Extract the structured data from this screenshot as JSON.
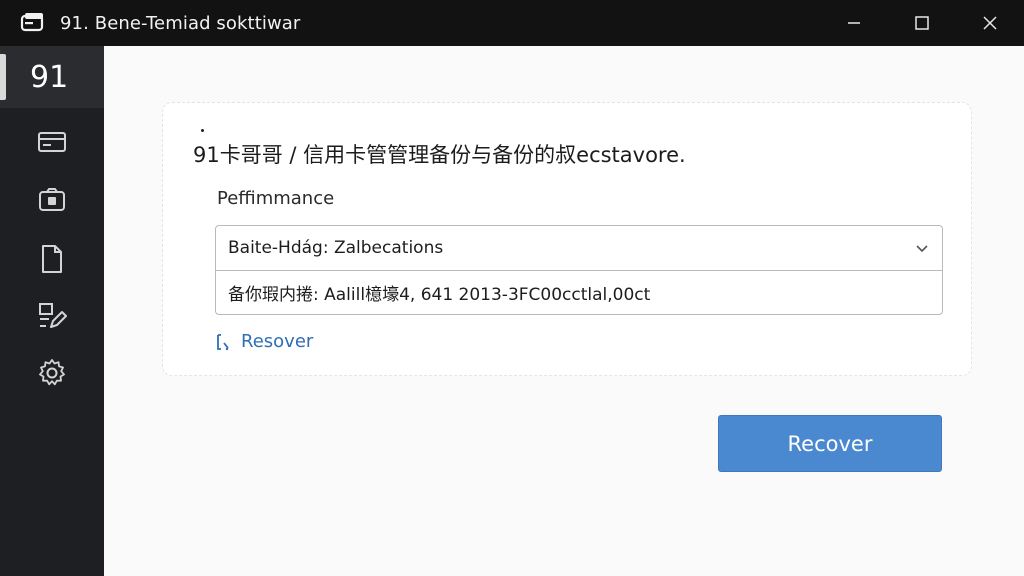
{
  "window": {
    "title": "91. Bene-Temiad sokttiwar"
  },
  "sidebar": {
    "logo": "91",
    "items": [
      {
        "icon": "card-icon"
      },
      {
        "icon": "camera-icon"
      },
      {
        "icon": "document-icon"
      },
      {
        "icon": "edit-icon"
      },
      {
        "icon": "settings-icon"
      }
    ]
  },
  "main": {
    "heading": "91卡哥哥 / 信用卡管管理备份与备份的叔ecstavore.",
    "field_label": "Peffimmance",
    "select_value": "Baite-Hdág: Zalbecations",
    "option_text": "备你瑕内捲: Aalill檍壕4, 641 2013-3FC00cctlal,00ct",
    "link_label": "Resover",
    "primary_button": "Recover"
  },
  "colors": {
    "titlebar": "#121212",
    "sidebar": "#1e1f22",
    "accent": "#4a88d0",
    "link": "#2f6db5"
  }
}
